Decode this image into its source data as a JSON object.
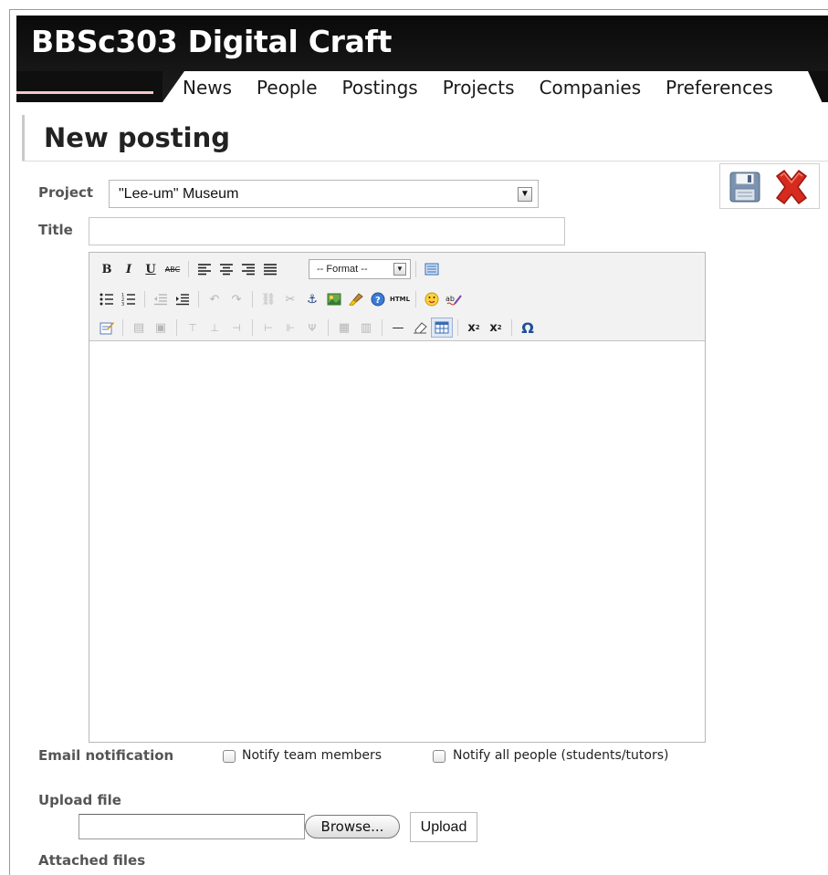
{
  "header": {
    "site_title": "BBSc303 Digital Craft",
    "nav": [
      {
        "label": "News"
      },
      {
        "label": "People"
      },
      {
        "label": "Postings"
      },
      {
        "label": "Projects"
      },
      {
        "label": "Companies"
      },
      {
        "label": "Preferences"
      }
    ]
  },
  "page": {
    "title": "New posting"
  },
  "actions": {
    "save_icon": "save-disk-icon",
    "cancel_icon": "red-x-icon"
  },
  "form": {
    "project_label": "Project",
    "project_value": "\"Lee-um\" Museum",
    "title_label": "Title",
    "title_value": ""
  },
  "editor": {
    "format_placeholder": "-- Format --",
    "html_label": "HTML",
    "content": ""
  },
  "notification": {
    "label": "Email notification",
    "team_label": "Notify team members",
    "team_checked": false,
    "all_label": "Notify all people (students/tutors)",
    "all_checked": false
  },
  "upload": {
    "label": "Upload file",
    "browse_label": "Browse...",
    "upload_label": "Upload"
  },
  "attached": {
    "label": "Attached files"
  },
  "colors": {
    "header_bg": "#111111",
    "accent_red": "#d62b1e"
  }
}
